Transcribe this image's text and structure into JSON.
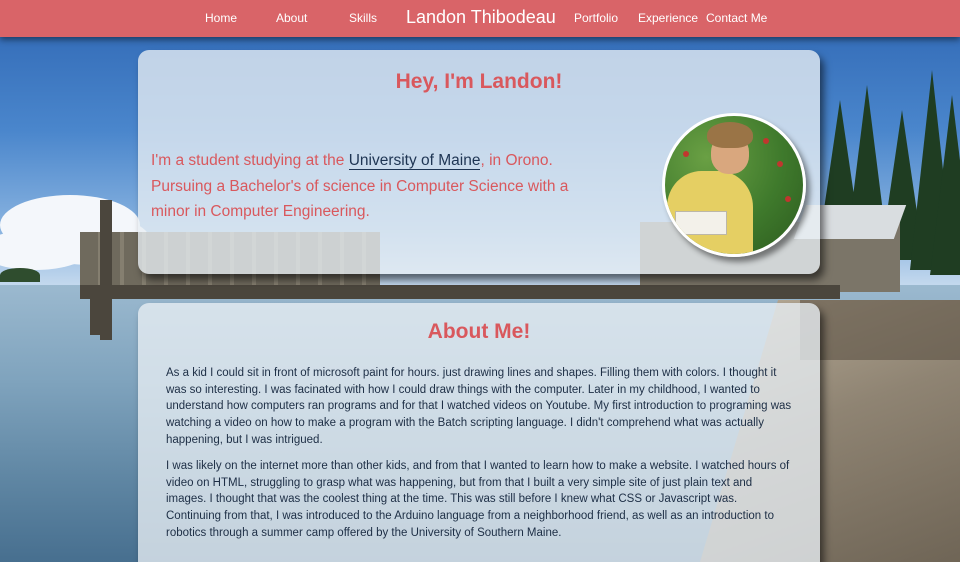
{
  "nav": {
    "items": [
      {
        "label": "Home"
      },
      {
        "label": "About"
      },
      {
        "label": "Skills"
      },
      {
        "label": "Portfolio"
      },
      {
        "label": "Experience"
      },
      {
        "label": "Contact Me"
      }
    ],
    "brand": "Landon Thibodeau"
  },
  "hero": {
    "title": "Hey, I'm Landon!",
    "text_before": "I'm a student studying at the ",
    "link_text": "University of Maine",
    "text_after": ", in Orono. Pursuing a Bachelor's of science in Computer Science with a minor in Computer Engineering."
  },
  "about": {
    "title": "About Me!",
    "paragraphs": [
      "As a kid I could sit in front of microsoft paint for hours. just drawing lines and shapes. Filling them with colors. I thought it was so interesting. I was facinated with how I could draw things with the computer. Later in my childhood, I wanted to understand how computers ran programs and for that I watched videos on Youtube. My first introduction to programing was watching a video on how to make a program with the Batch scripting language. I didn't comprehend what was actually happening, but I was intrigued.",
      "I was likely on the internet more than other kids, and from that I wanted to learn how to make a website. I watched hours of video on HTML, struggling to grasp what was happening, but from that I built a very simple site of just plain text and images. I thought that was the coolest thing at the time. This was still before I knew what CSS or Javascript was. Continuing from that, I was introduced to the Arduino language from a neighborhood friend, as well as an introduction to robotics through a summer camp offered by the University of Southern Maine."
    ]
  },
  "colors": {
    "nav_background": "#d96468",
    "accent": "#d9585d",
    "card_background": "#e8eef4",
    "body_text": "#1d2e45",
    "link": "#1e3553"
  }
}
